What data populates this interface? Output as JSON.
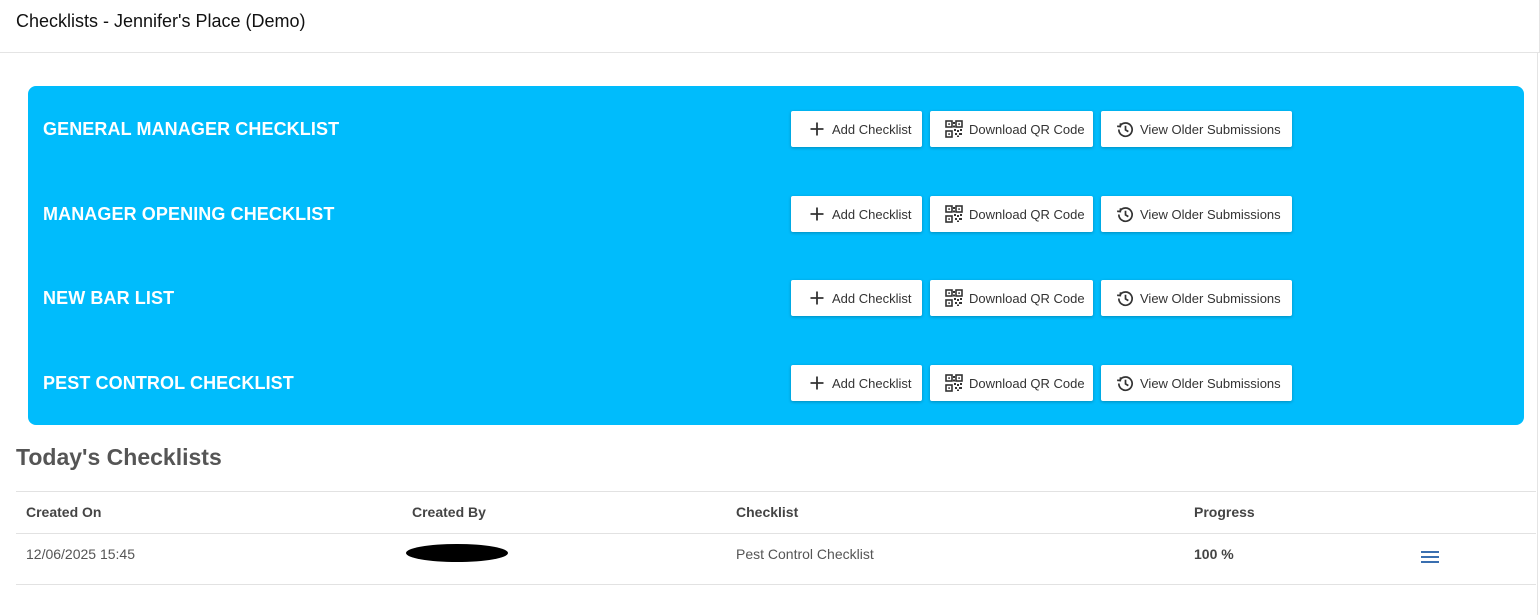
{
  "header": {
    "title": "Checklists - Jennifer's Place (Demo)"
  },
  "colors": {
    "panel": "#00bcfc",
    "menu_icon": "#3a6fb0"
  },
  "checklists": [
    {
      "name": "GENERAL MANAGER CHECKLIST"
    },
    {
      "name": "MANAGER OPENING CHECKLIST"
    },
    {
      "name": "NEW BAR LIST"
    },
    {
      "name": "PEST CONTROL CHECKLIST"
    }
  ],
  "buttons": {
    "add_label": "Add Checklist",
    "add_icon": "plus-icon",
    "qr_label": "Download QR Code",
    "qr_icon": "qr-code-icon",
    "history_label": "View Older Submissions",
    "history_icon": "history-icon"
  },
  "today": {
    "title": "Today's Checklists",
    "columns": [
      "Created On",
      "Created By",
      "Checklist",
      "Progress"
    ],
    "rows": [
      {
        "created_on": "12/06/2025 15:45",
        "created_by": "",
        "checklist": "Pest Control Checklist",
        "progress": "100 %",
        "action_icon": "menu-icon"
      }
    ]
  }
}
